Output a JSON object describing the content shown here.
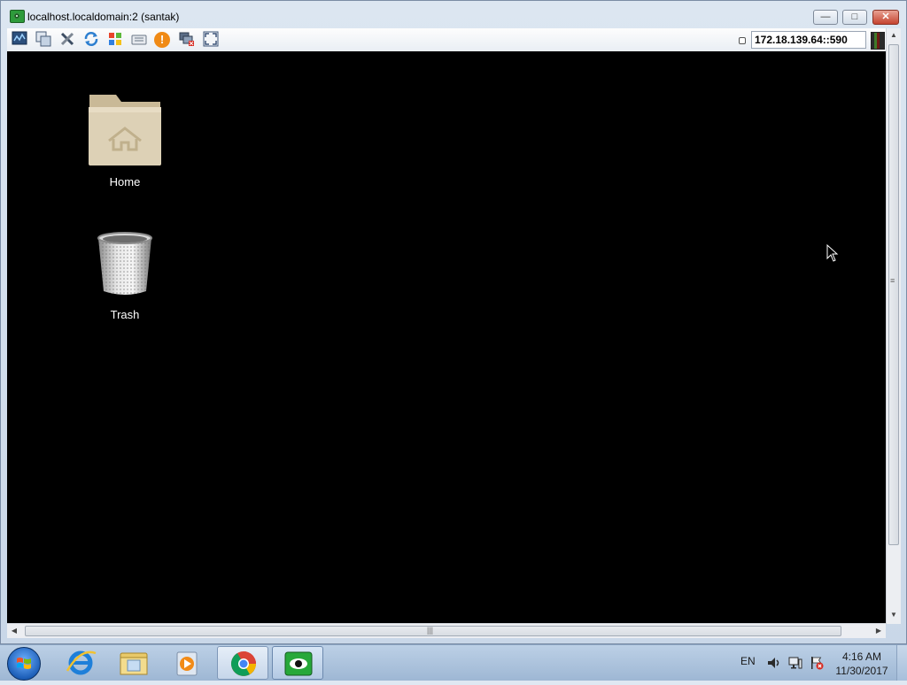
{
  "window": {
    "title": "localhost.localdomain:2 (santak)",
    "minimize_label": "—",
    "maximize_label": "□",
    "close_label": "✕"
  },
  "toolbar": {
    "address": "172.18.139.64::590",
    "icons": [
      "connection-info-icon",
      "copy-icon",
      "options-icon",
      "refresh-icon",
      "windows-key-icon",
      "keyboard-icon",
      "alert-icon",
      "disconnect-icon",
      "fullscreen-icon"
    ]
  },
  "desktop": {
    "background": "#000000",
    "icons": [
      {
        "label": "Home",
        "icon": "home-folder-icon"
      },
      {
        "label": "Trash",
        "icon": "trash-icon"
      }
    ]
  },
  "taskbar": {
    "apps": [
      "internet-explorer-icon",
      "file-explorer-icon",
      "media-player-icon",
      "chrome-icon",
      "vnc-viewer-icon"
    ],
    "language": "EN",
    "time": "4:16 AM",
    "date": "11/30/2017"
  }
}
